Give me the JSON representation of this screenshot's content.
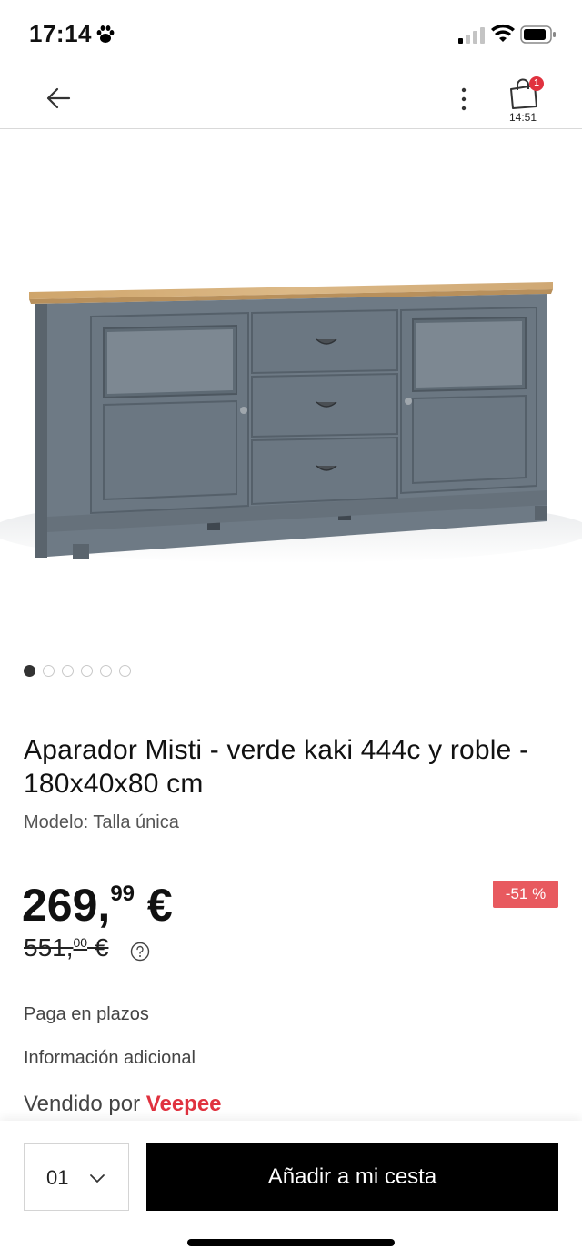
{
  "status_bar": {
    "time": "17:14",
    "icons": [
      "paw-icon",
      "signal-icon",
      "wifi-icon",
      "battery-icon"
    ]
  },
  "nav": {
    "icons": [
      "back-arrow-icon",
      "more-vertical-icon",
      "shopping-bag-icon"
    ],
    "cart_badge": "1",
    "cart_timer": "14:51"
  },
  "gallery": {
    "image": "sideboard-product-photo",
    "total_images": 6,
    "active_index": 0
  },
  "product": {
    "title": "Aparador Misti - verde kaki 444c y roble - 180x40x80 cm",
    "model": "Modelo: Talla única"
  },
  "price": {
    "current_int": "269,",
    "current_dec": "99",
    "current_currency": " €",
    "old_int": "551,",
    "old_dec": "00",
    "old_currency": " €",
    "discount": "-51 %"
  },
  "links": {
    "installments": "Paga en plazos",
    "additional_info": "Información adicional"
  },
  "seller": {
    "label": "Vendido por ",
    "name": "Veepee"
  },
  "bottom_bar": {
    "quantity": "01",
    "add_to_cart": "Añadir a mi cesta"
  },
  "colors": {
    "accent_red": "#e0323f",
    "discount_bg": "#e85a5f",
    "button_bg": "#000000",
    "furniture_body": "#6b7782",
    "furniture_top": "#d9b47c"
  }
}
